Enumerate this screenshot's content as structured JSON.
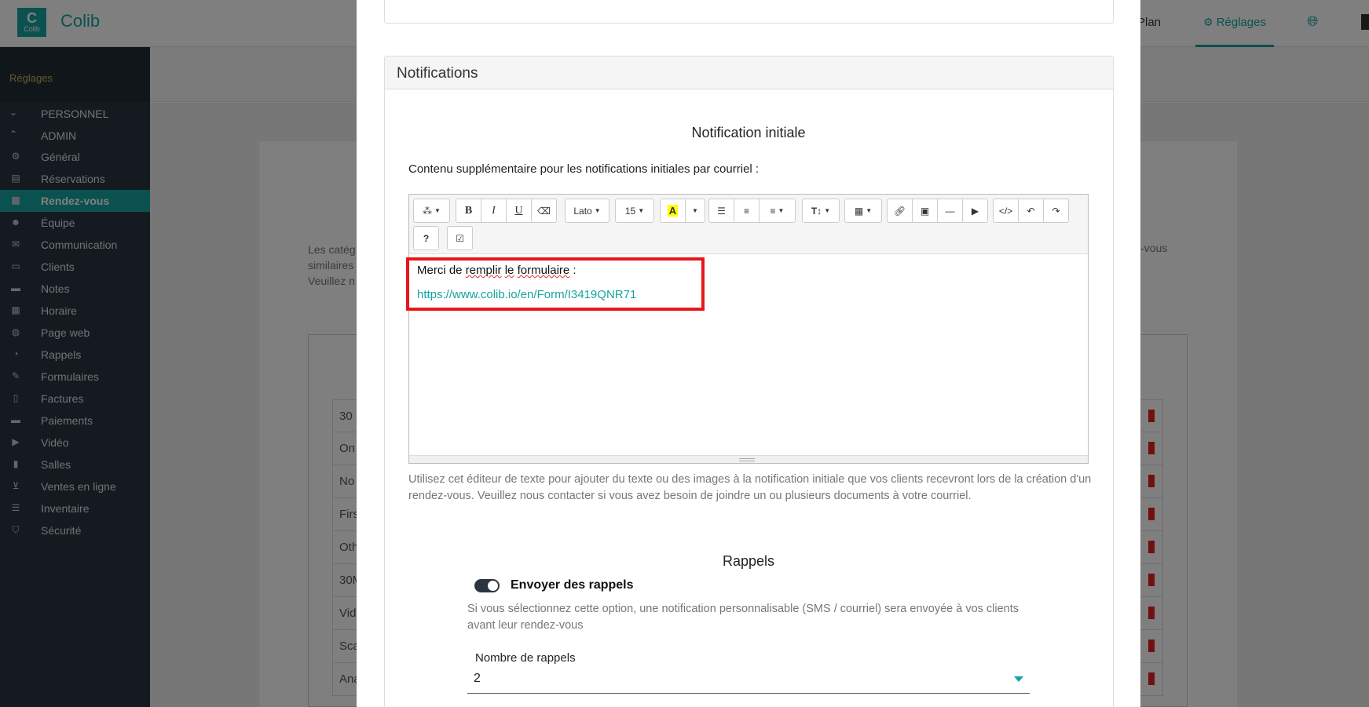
{
  "app": {
    "name": "Colib",
    "logo_text": "Colib"
  },
  "top_nav": {
    "plan_label": "Plan",
    "reglages_label": "Réglages"
  },
  "sidebar": {
    "header": "Réglages",
    "sections": [
      {
        "label": "PERSONNEL",
        "expanded": false
      },
      {
        "label": "ADMIN",
        "expanded": true
      }
    ],
    "items": [
      {
        "label": "Général",
        "icon": "gear-icon"
      },
      {
        "label": "Réservations",
        "icon": "clipboard-icon"
      },
      {
        "label": "Rendez-vous",
        "icon": "calendar-icon",
        "active": true
      },
      {
        "label": "Équipe",
        "icon": "users-icon"
      },
      {
        "label": "Communication",
        "icon": "envelope-icon"
      },
      {
        "label": "Clients",
        "icon": "id-card-icon"
      },
      {
        "label": "Notes",
        "icon": "note-icon"
      },
      {
        "label": "Horaire",
        "icon": "calendar-grid-icon"
      },
      {
        "label": "Page web",
        "icon": "globe-icon"
      },
      {
        "label": "Rappels",
        "icon": "stopwatch-icon"
      },
      {
        "label": "Formulaires",
        "icon": "form-edit-icon"
      },
      {
        "label": "Factures",
        "icon": "invoice-icon"
      },
      {
        "label": "Paiements",
        "icon": "credit-card-icon"
      },
      {
        "label": "Vidéo",
        "icon": "video-icon"
      },
      {
        "label": "Salles",
        "icon": "door-icon"
      },
      {
        "label": "Ventes en ligne",
        "icon": "cart-icon"
      },
      {
        "label": "Inventaire",
        "icon": "list-icon"
      },
      {
        "label": "Sécurité",
        "icon": "shield-icon"
      }
    ]
  },
  "background": {
    "para_lines": [
      "Les catég",
      "similaires",
      "Veuillez n"
    ],
    "para_right": "-vous",
    "table_rows": [
      "30",
      "On",
      "No",
      "Firs",
      "Oth",
      "30M",
      "Vid",
      "Sca",
      "Ana"
    ]
  },
  "modal": {
    "panel_title": "Notifications",
    "initial": {
      "title": "Notification initiale",
      "label": "Contenu supplémentaire pour les notifications initiales par courriel :",
      "toolbar": {
        "font_name": "Lato",
        "font_size": "15",
        "highlight_letter": "A",
        "help_label": "?"
      },
      "content": {
        "line1_parts": [
          "Merci de ",
          "remplir",
          " ",
          "le",
          " ",
          "formulaire",
          " :"
        ],
        "link": "https://www.colib.io/en/Form/I3419QNR71"
      },
      "help": "Utilisez cet éditeur de texte pour ajouter du texte ou des images à la notification initiale que vos clients recevront lors de la création d'un rendez-vous. Veuillez nous contacter si vous avez besoin de joindre un ou plusieurs documents à votre courriel."
    },
    "reminders": {
      "title": "Rappels",
      "toggle_label": "Envoyer des rappels",
      "toggle_on": true,
      "help": "Si vous sélectionnez cette option, une notification personnalisable (SMS / courriel) sera envoyée à vos clients avant leur rendez-vous",
      "count_label": "Nombre de rappels",
      "count_value": "2"
    }
  },
  "colors": {
    "accent": "#16a3a0",
    "sidebar": "#2a3540",
    "highlight_box": "#e8161b"
  }
}
